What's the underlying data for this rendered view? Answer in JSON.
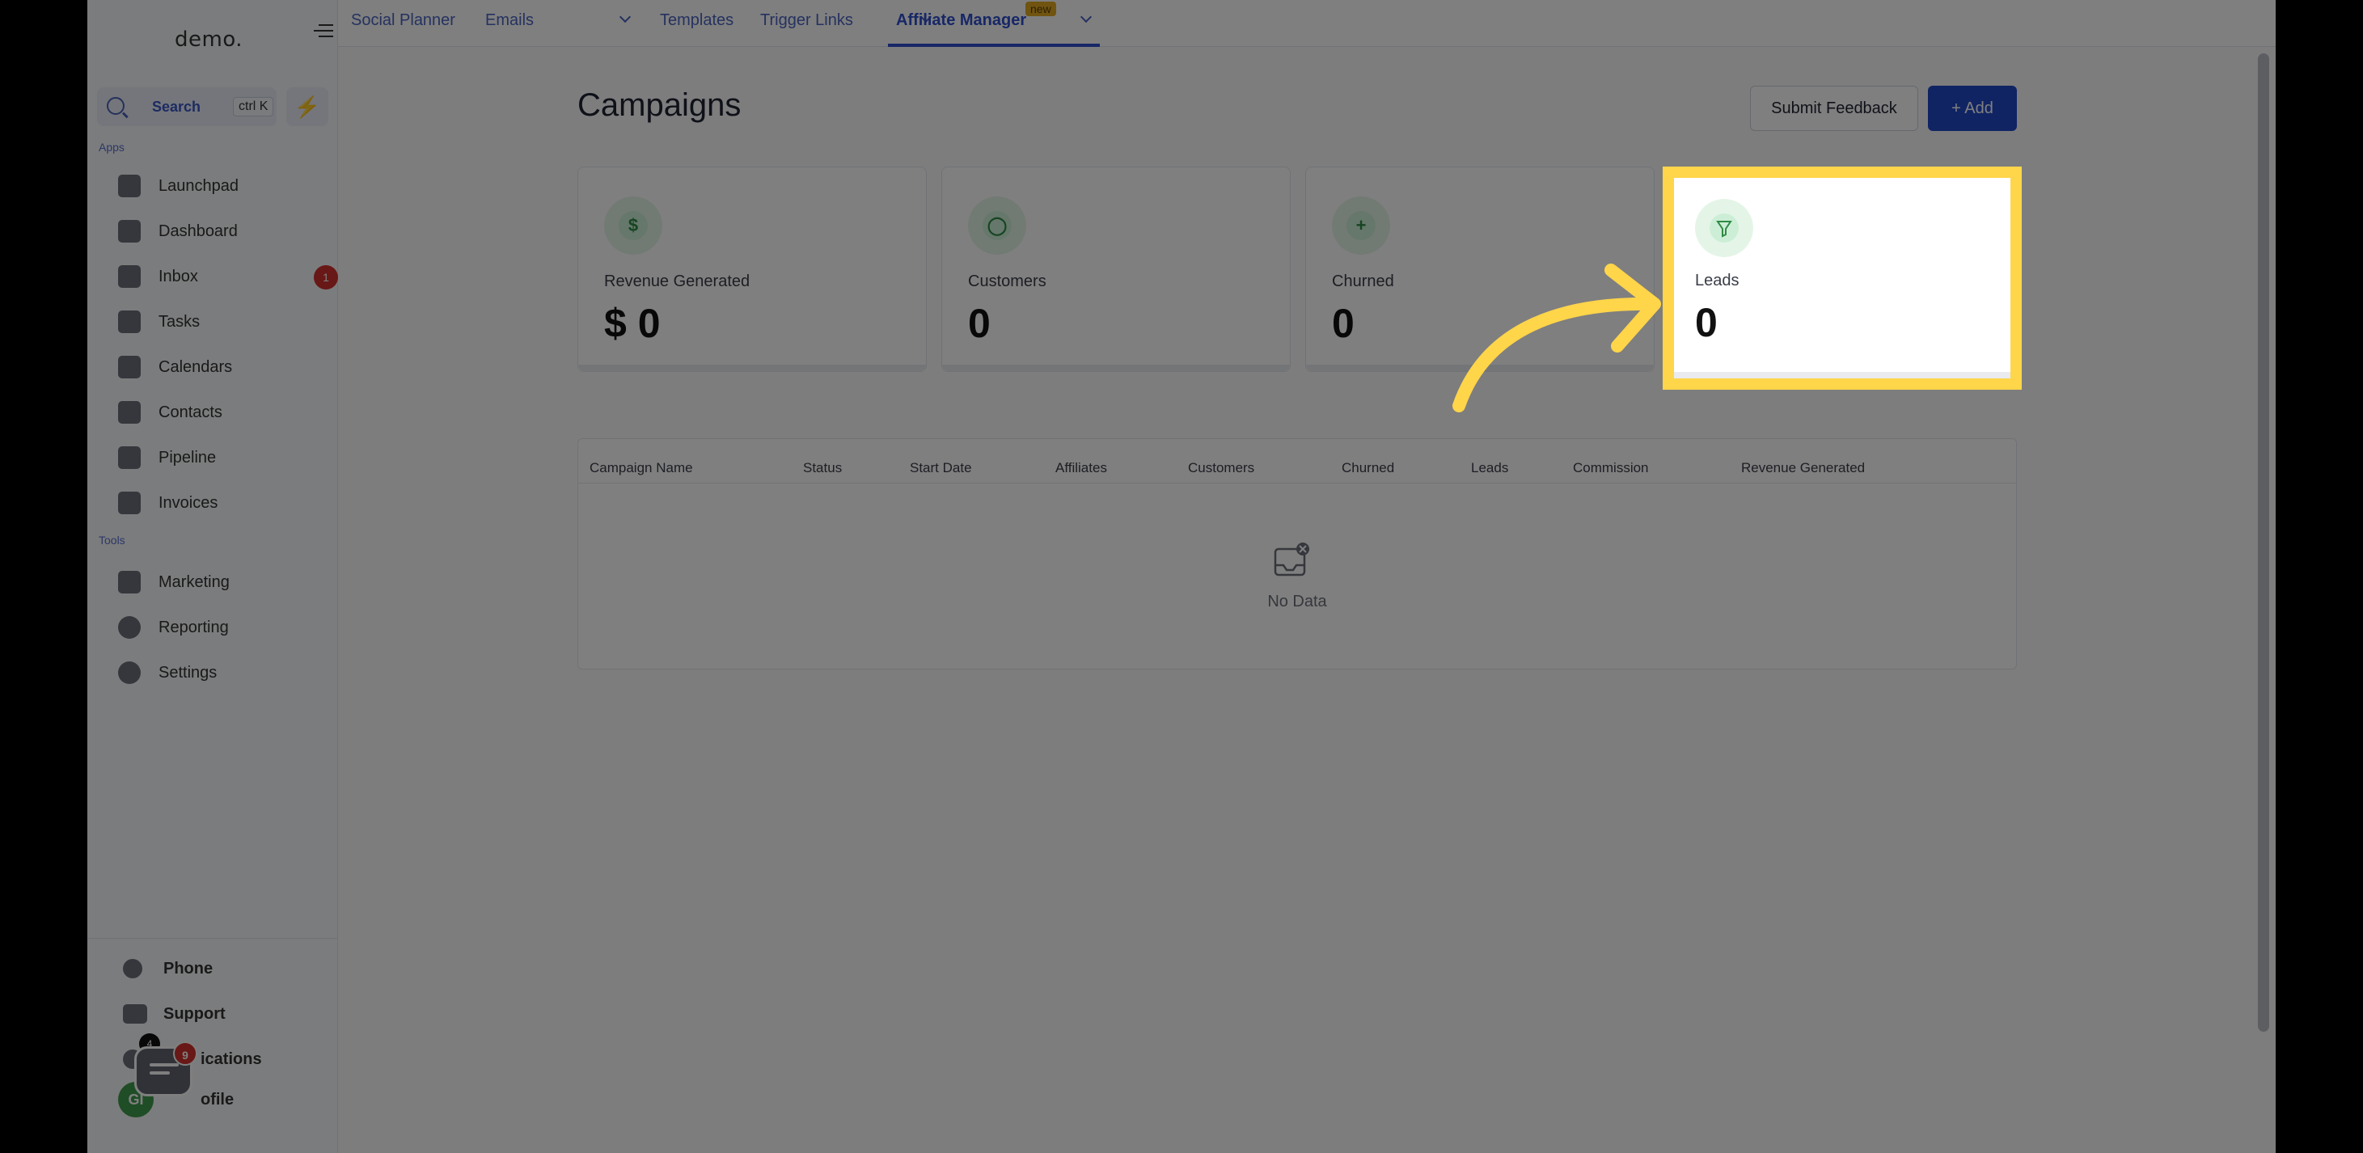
{
  "sidebar": {
    "logo": "demo.",
    "search_label": "Search",
    "search_shortcut": "ctrl K",
    "apps_label": "Apps",
    "tools_label": "Tools",
    "items": [
      {
        "label": "Launchpad",
        "icon": "rocket-icon"
      },
      {
        "label": "Dashboard",
        "icon": "grid-icon"
      },
      {
        "label": "Inbox",
        "icon": "inbox-icon",
        "badge": "1"
      },
      {
        "label": "Tasks",
        "icon": "clipboard-icon"
      },
      {
        "label": "Calendars",
        "icon": "calendar-icon"
      },
      {
        "label": "Contacts",
        "icon": "person-icon"
      },
      {
        "label": "Pipeline",
        "icon": "funnel-icon"
      },
      {
        "label": "Invoices",
        "icon": "invoice-icon"
      }
    ],
    "tools": [
      {
        "label": "Marketing",
        "icon": "megaphone-icon"
      },
      {
        "label": "Reporting",
        "icon": "pie-chart-icon"
      },
      {
        "label": "Settings",
        "icon": "gear-icon"
      }
    ],
    "bottom": [
      {
        "label": "Phone",
        "icon": "phone-icon"
      },
      {
        "label": "Support",
        "icon": "chat-icon"
      },
      {
        "label": "ications",
        "icon": "bell-icon"
      },
      {
        "label": "ofile",
        "icon": "avatar-icon"
      }
    ],
    "chat_badge": "9",
    "avatar_initials": "GI",
    "dot_label": "4"
  },
  "topnav": {
    "tabs": [
      {
        "label": "Social Planner"
      },
      {
        "label": "Emails"
      },
      {
        "label": "Templates"
      },
      {
        "label": "Trigger Links"
      },
      {
        "label": "Affiliate Manager"
      }
    ],
    "new_badge": "new"
  },
  "main": {
    "title": "Campaigns",
    "submit_feedback": "Submit Feedback",
    "add_label": "+ Add",
    "cards": [
      {
        "label": "Revenue Generated",
        "value": "$ 0"
      },
      {
        "label": "Customers",
        "value": "0"
      },
      {
        "label": "Churned",
        "value": "0"
      },
      {
        "label": "Leads",
        "value": "0"
      }
    ],
    "table": {
      "columns": [
        "Campaign Name",
        "Status",
        "Start Date",
        "Affiliates",
        "Customers",
        "Churned",
        "Leads",
        "Commission",
        "Revenue Generated"
      ],
      "empty_text": "No Data"
    }
  },
  "colors": {
    "accent": "#2148c8",
    "highlight": "#ffd54a",
    "icon_green": "#2f8a45"
  }
}
